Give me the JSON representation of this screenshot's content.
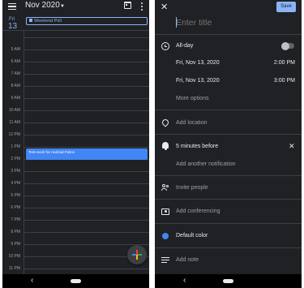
{
  "calendar": {
    "month_title": "Nov 2020",
    "day_name": "Fri",
    "day_number": "13",
    "allday_event": "Weekend Poll",
    "hours": [
      "5 AM",
      "6 AM",
      "7 AM",
      "8 AM",
      "9 AM",
      "10 AM",
      "11 AM",
      "12 PM",
      "1 PM",
      "2 PM",
      "3 PM",
      "4 PM",
      "5 PM",
      "6 PM",
      "7 PM",
      "8 PM",
      "9 PM",
      "10 PM",
      "11 PM"
    ],
    "event_block": "Test event for Android Police",
    "icons": {
      "menu": "hamburger-menu-icon",
      "month_caret": "chevron-down-icon",
      "today": "calendar-today-icon",
      "more": "more-vert-icon",
      "fab": "google-plus-icon"
    },
    "colors": {
      "background": "#202124",
      "accent": "#8ab4f8",
      "event": "#4285f4"
    }
  },
  "editor": {
    "close_icon": "close-icon",
    "save_label": "Save",
    "title_placeholder": "Enter title",
    "all_day_label": "All-day",
    "all_day_enabled": false,
    "start_date": "Fri, Nov 13, 2020",
    "start_time": "2:00 PM",
    "end_date": "Fri, Nov 13, 2020",
    "end_time": "3:00 PM",
    "more_options": "More options",
    "add_location": "Add location",
    "notification": "5 minutes before",
    "add_notification": "Add another notification",
    "invite_people": "Invite people",
    "add_conferencing": "Add conferencing",
    "default_color": "Default color",
    "add_note": "Add note",
    "colors": {
      "save_button": "#8ab4f8",
      "default_color_dot": "#4285f4"
    }
  },
  "system_nav": {
    "back_icon": "back-icon",
    "home_icon": "home-pill-icon"
  }
}
